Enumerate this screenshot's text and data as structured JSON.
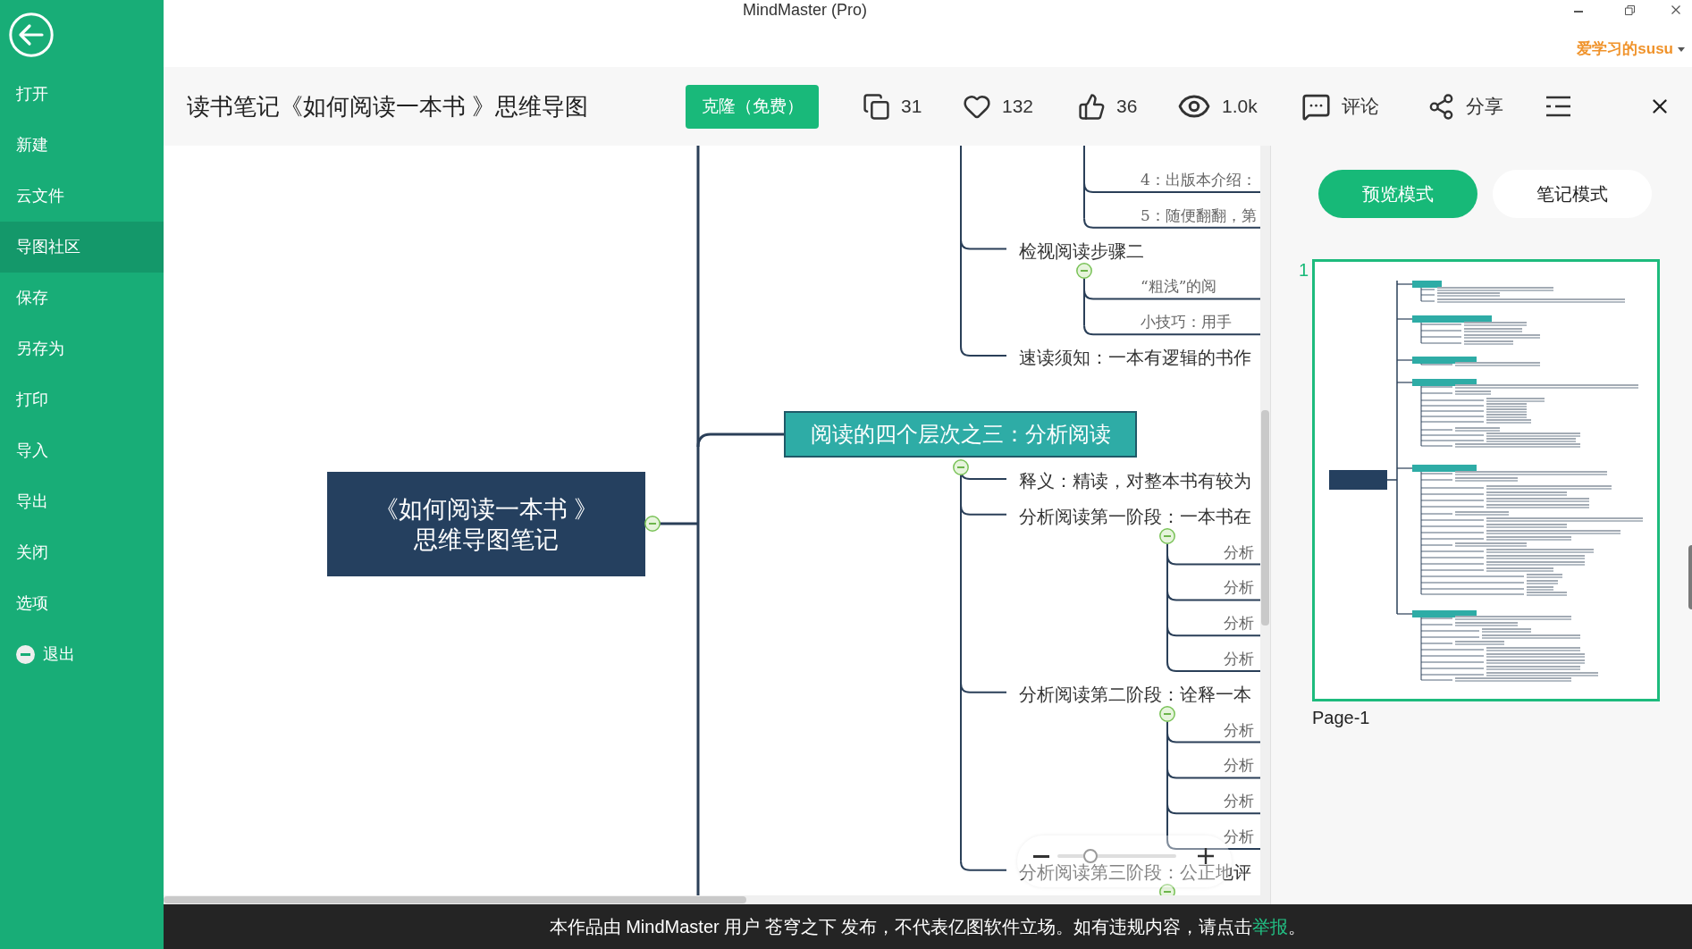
{
  "window": {
    "title": "MindMaster (Pro)"
  },
  "account": {
    "username": "爱学习的susu"
  },
  "sidebar": {
    "items": [
      {
        "label": "打开",
        "kind": "plain",
        "selected": false
      },
      {
        "label": "新建",
        "kind": "plain",
        "selected": false
      },
      {
        "label": "云文件",
        "kind": "plain",
        "selected": false
      },
      {
        "label": "导图社区",
        "kind": "plain",
        "selected": true
      },
      {
        "label": "保存",
        "kind": "plain",
        "selected": false
      },
      {
        "label": "另存为",
        "kind": "plain",
        "selected": false
      },
      {
        "label": "打印",
        "kind": "plain",
        "selected": false
      },
      {
        "label": "导入",
        "kind": "plain",
        "selected": false
      },
      {
        "label": "导出",
        "kind": "plain",
        "selected": false
      },
      {
        "label": "关闭",
        "kind": "plain",
        "selected": false
      },
      {
        "label": "选项",
        "kind": "plain",
        "selected": false
      },
      {
        "label": "退出",
        "kind": "exit",
        "selected": false
      }
    ]
  },
  "toolbar": {
    "title": "读书笔记《如何阅读一本书 》思维导图",
    "clone_button": "克隆（免费）",
    "stats": [
      {
        "kind": "copies",
        "text": "31"
      },
      {
        "kind": "favorites",
        "text": "132"
      },
      {
        "kind": "likes",
        "text": "36"
      },
      {
        "kind": "views",
        "text": "1.0k"
      },
      {
        "kind": "comments",
        "text": "评论"
      },
      {
        "kind": "share",
        "text": "分享"
      }
    ]
  },
  "mind_map": {
    "root": {
      "lines": [
        "《如何阅读一本书 》",
        "思维导图笔记"
      ],
      "expanded": true
    },
    "topics": [
      {
        "children": [
          {
            "children": [
              {
                "text": "4：出版本介绍："
              },
              {
                "text": "5：随便翻翻，第"
              }
            ]
          },
          {
            "text": "检视阅读步骤二",
            "expanded": true,
            "children": [
              {
                "text": "“粗浅”的阅"
              },
              {
                "text": "小技巧：用手"
              }
            ]
          },
          {
            "text": "速读须知：一本有逻辑的书作"
          }
        ]
      },
      {
        "text": "阅读的四个层次之三：分析阅读",
        "expanded": true,
        "children": [
          {
            "text": "释义：精读，对整本书有较为"
          },
          {
            "text": "分析阅读第一阶段：一本书在",
            "expanded": true,
            "children": [
              {
                "text": "分析"
              },
              {
                "text": "分析"
              },
              {
                "text": "分析"
              },
              {
                "text": "分析"
              }
            ]
          },
          {
            "text": "分析阅读第二阶段：诠释一本",
            "expanded": true,
            "children": [
              {
                "text": "分析"
              },
              {
                "text": "分析"
              },
              {
                "text": "分析"
              },
              {
                "text": "分析"
              }
            ]
          },
          {
            "text": "分析阅读第三阶段：公正地评",
            "expanded": true
          }
        ]
      }
    ],
    "zoom": {
      "level": 0.25
    }
  },
  "side_panel": {
    "modes": [
      {
        "label": "预览模式",
        "selected": true
      },
      {
        "label": "笔记模式",
        "selected": false
      }
    ],
    "pages": [
      {
        "number": "1",
        "label": "Page-1",
        "selected": true
      }
    ]
  },
  "notice": {
    "text": "本作品由 MindMaster 用户 苍穹之下 发布，不代表亿图软件立场。如有违规内容，请点击",
    "link": "举报",
    "end": "。"
  }
}
